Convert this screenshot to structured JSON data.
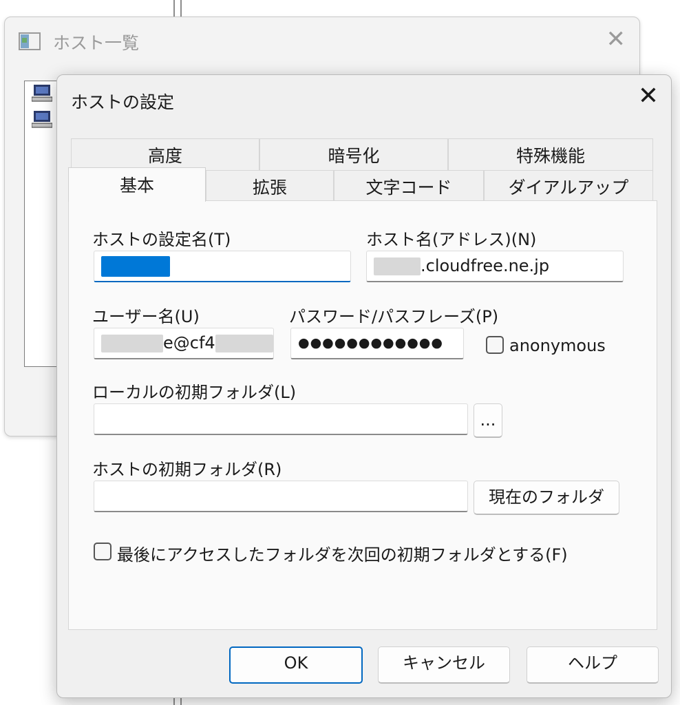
{
  "back_window": {
    "title": "ホスト一覧",
    "close": "✕"
  },
  "dialog": {
    "title": "ホストの設定",
    "close": "✕",
    "tabs_top": [
      "高度",
      "暗号化",
      "特殊機能"
    ],
    "tabs_bottom": [
      "基本",
      "拡張",
      "文字コード",
      "ダイアルアップ"
    ],
    "active_tab": "基本",
    "host_setting_name": {
      "label": "ホストの設定名(T)",
      "value": ""
    },
    "host_name": {
      "label": "ホスト名(アドレス)(N)",
      "value_visible": ".cloudfree.ne.jp"
    },
    "username": {
      "label": "ユーザー名(U)",
      "value_visible": "e@cf4"
    },
    "password": {
      "label": "パスワード/パスフレーズ(P)",
      "value": "●●●●●●●●●●●●"
    },
    "anonymous": {
      "label": "anonymous",
      "checked": false
    },
    "local_folder": {
      "label": "ローカルの初期フォルダ(L)",
      "value": "",
      "browse_label": "..."
    },
    "host_folder": {
      "label": "ホストの初期フォルダ(R)",
      "value": "",
      "current_folder_label": "現在のフォルダ"
    },
    "remember_last_folder": {
      "label": "最後にアクセスしたフォルダを次回の初期フォルダとする(F)",
      "checked": false
    },
    "buttons": {
      "ok": "OK",
      "cancel": "キャンセル",
      "help": "ヘルプ"
    }
  }
}
